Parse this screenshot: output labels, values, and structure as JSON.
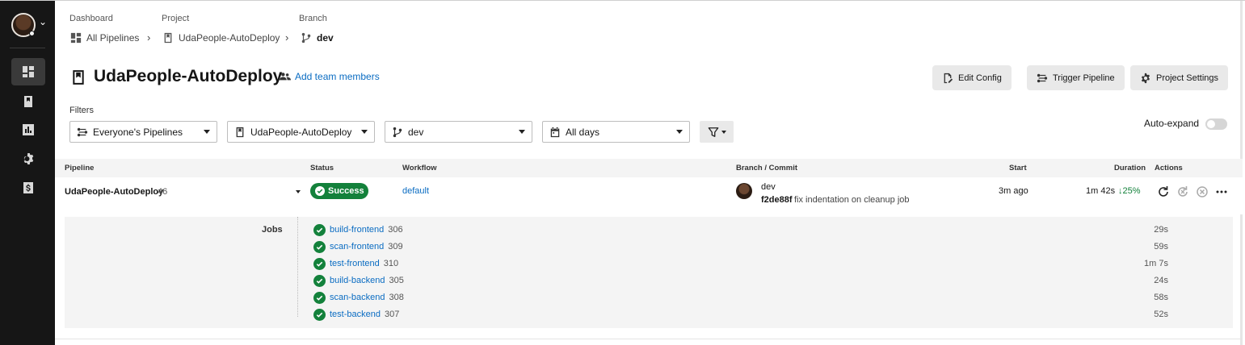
{
  "breadcrumb": {
    "dashboard_label": "Dashboard",
    "project_label": "Project",
    "branch_label": "Branch",
    "all_pipelines": "All Pipelines",
    "project": "UdaPeople-AutoDeploy",
    "branch": "dev"
  },
  "header": {
    "title": "UdaPeople-AutoDeploy",
    "add_team_members": "Add team members",
    "edit_config": "Edit Config",
    "trigger_pipeline": "Trigger Pipeline",
    "project_settings": "Project Settings"
  },
  "filters": {
    "label": "Filters",
    "pipelines": "Everyone's Pipelines",
    "project": "UdaPeople-AutoDeploy",
    "branch": "dev",
    "date": "All days",
    "auto_expand": "Auto-expand"
  },
  "table": {
    "headers": [
      "Pipeline",
      "Status",
      "Workflow",
      "Branch / Commit",
      "Start",
      "Duration",
      "Actions"
    ],
    "row": {
      "pipeline": "UdaPeople-AutoDeploy",
      "number": "46",
      "status": "Success",
      "workflow": "default",
      "branch": "dev",
      "commit_sha": "f2de88f",
      "commit_message": "fix indentation on cleanup job",
      "start": "3m ago",
      "duration": "1m 42s",
      "delta": "25%"
    }
  },
  "jobs": {
    "label": "Jobs",
    "items": [
      {
        "name": "build-frontend",
        "number": "306",
        "duration": "29s"
      },
      {
        "name": "scan-frontend",
        "number": "309",
        "duration": "59s"
      },
      {
        "name": "test-frontend",
        "number": "310",
        "duration": "1m 7s"
      },
      {
        "name": "build-backend",
        "number": "305",
        "duration": "24s"
      },
      {
        "name": "scan-backend",
        "number": "308",
        "duration": "58s"
      },
      {
        "name": "test-backend",
        "number": "307",
        "duration": "52s"
      }
    ]
  },
  "colors": {
    "success": "#13813b",
    "link": "#0a6cc2",
    "sidebar": "#161616"
  }
}
